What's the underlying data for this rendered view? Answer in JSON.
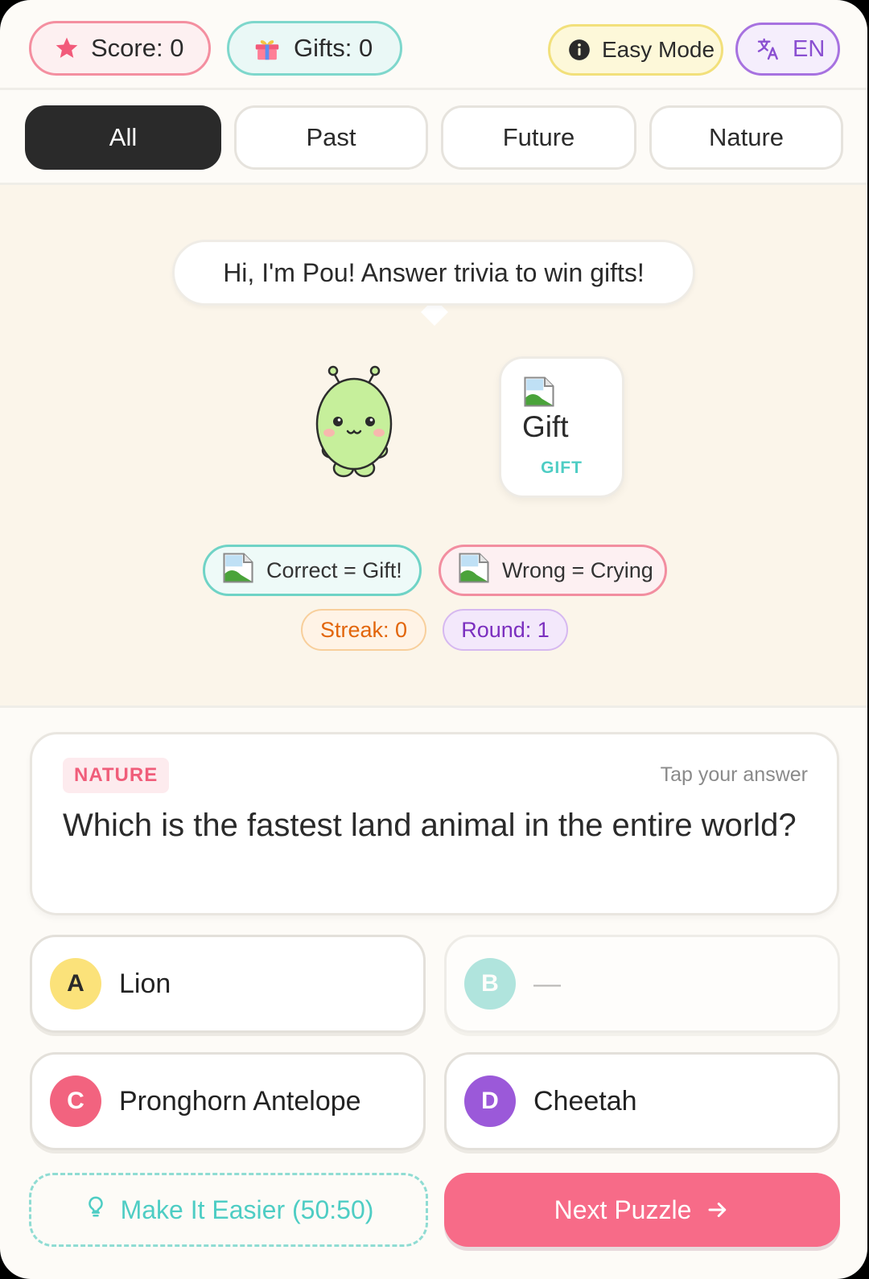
{
  "header": {
    "score_label": "Score: 0",
    "gifts_label": "Gifts: 0",
    "mode_label": "Easy Mode",
    "language_label": "EN"
  },
  "tabs": [
    {
      "label": "All",
      "active": true
    },
    {
      "label": "Past",
      "active": false
    },
    {
      "label": "Future",
      "active": false
    },
    {
      "label": "Nature",
      "active": false
    }
  ],
  "stage": {
    "speech": "Hi, I'm Pou! Answer trivia to win gifts!",
    "gift_card": {
      "alt": "Gift",
      "tag": "GIFT"
    },
    "legend": {
      "correct": "Correct = Gift!",
      "wrong": "Wrong = Crying"
    },
    "streak_label": "Streak: 0",
    "round_label": "Round: 1"
  },
  "question": {
    "category": "NATURE",
    "hint": "Tap your answer",
    "text": "Which is the fastest land animal in the entire world?"
  },
  "answers": [
    {
      "letter": "A",
      "label": "Lion"
    },
    {
      "letter": "B",
      "label": "—"
    },
    {
      "letter": "C",
      "label": "Pronghorn Antelope"
    },
    {
      "letter": "D",
      "label": "Cheetah"
    }
  ],
  "actions": {
    "easier_label": "Make It Easier (50:50)",
    "next_label": "Next Puzzle"
  },
  "colors": {
    "accent_pink": "#f76b88",
    "accent_teal": "#4ecdc4",
    "accent_purple": "#9b59d9",
    "accent_yellow": "#fbe27a"
  }
}
